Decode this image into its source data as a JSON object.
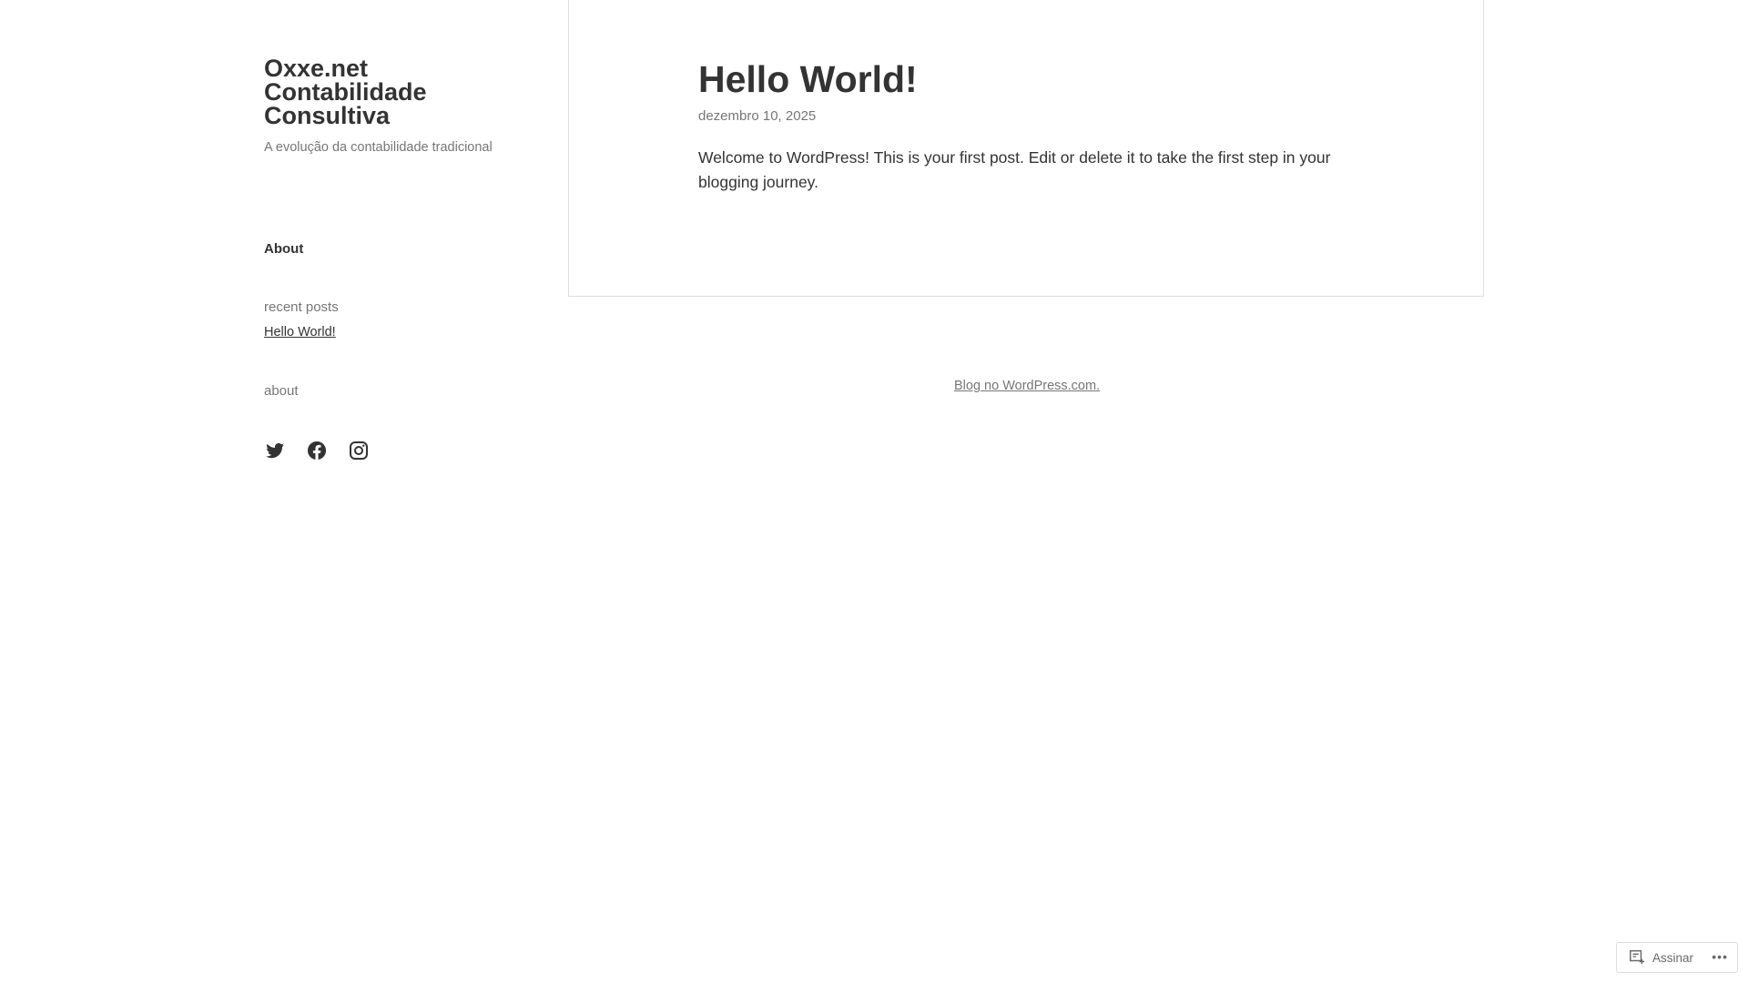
{
  "site": {
    "title": "Oxxe.net Contabilidade Consultiva",
    "tagline": "A evolução da contabilidade tradicional"
  },
  "nav": {
    "about": "About"
  },
  "widgets": {
    "recent_posts_title": "recent posts",
    "recent_posts": [
      "Hello World!"
    ],
    "about_title": "about"
  },
  "social": [
    "twitter-icon",
    "facebook-icon",
    "instagram-icon"
  ],
  "post": {
    "title": "Hello World!",
    "date": "dezembro 10, 2025",
    "body": "Welcome to WordPress! This is your first post. Edit or delete it to take the first step in your blogging journey."
  },
  "footer": {
    "credit": "Blog no WordPress.com."
  },
  "subscribe": {
    "label": "Assinar",
    "more": "•••"
  }
}
